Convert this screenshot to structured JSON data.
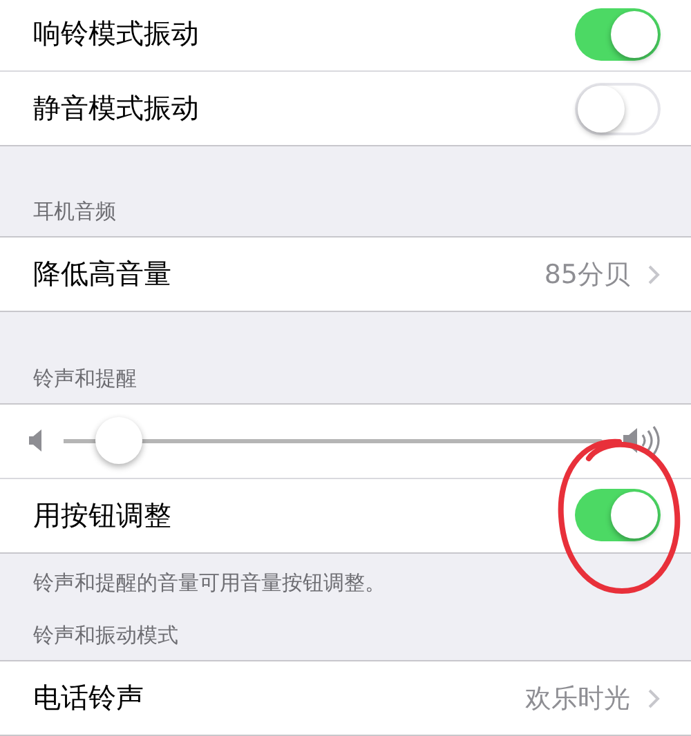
{
  "groups": [
    {
      "rows": [
        {
          "kind": "toggle",
          "label": "响铃模式振动",
          "on": true
        },
        {
          "kind": "toggle",
          "label": "静音模式振动",
          "on": false
        }
      ]
    },
    {
      "header": "耳机音频",
      "rows": [
        {
          "kind": "link",
          "label": "降低高音量",
          "value": "85分贝"
        }
      ]
    },
    {
      "header": "铃声和提醒",
      "footer": "铃声和提醒的音量可用音量按钮调整。",
      "rows": [
        {
          "kind": "slider",
          "level": 0.07
        },
        {
          "kind": "toggle",
          "label": "用按钮调整",
          "on": true,
          "annotated": true
        }
      ]
    },
    {
      "header": "铃声和振动模式",
      "rows": [
        {
          "kind": "link",
          "label": "电话铃声",
          "value": "欢乐时光"
        }
      ]
    }
  ]
}
